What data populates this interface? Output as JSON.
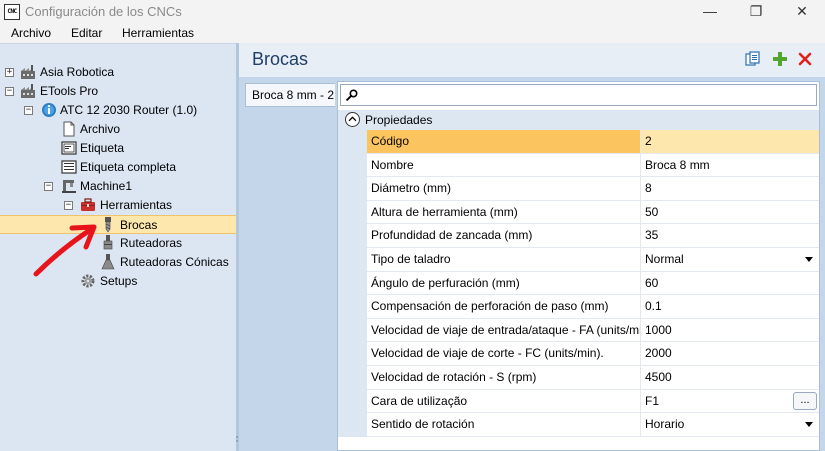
{
  "window": {
    "icon_text": "CNC",
    "title": "Configuración de los CNCs",
    "controls": {
      "minimize": "—",
      "maximize": "❐",
      "close": "✕"
    }
  },
  "menu": [
    "Archivo",
    "Editar",
    "Herramientas"
  ],
  "tree": {
    "items": [
      {
        "label": "Asia Robotica",
        "expander": "+",
        "icon": "factory-icon"
      },
      {
        "label": "ETools Pro",
        "expander": "−",
        "icon": "factory-icon"
      },
      {
        "label": "ATC 12 2030 Router (1.0)",
        "expander": "−",
        "icon": "info-globe-icon"
      },
      {
        "label": "Archivo",
        "icon": "document-icon"
      },
      {
        "label": "Etiqueta",
        "icon": "label-icon"
      },
      {
        "label": "Etiqueta completa",
        "icon": "full-label-icon"
      },
      {
        "label": "Machine1",
        "expander": "−",
        "icon": "machine-icon"
      },
      {
        "label": "Herramientas",
        "expander": "−",
        "icon": "toolbox-icon"
      },
      {
        "label": "Brocas",
        "icon": "drill-bit-icon",
        "selected": true
      },
      {
        "label": "Ruteadoras",
        "icon": "router-bit-icon"
      },
      {
        "label": "Ruteadoras Cónicas",
        "icon": "conical-router-icon"
      },
      {
        "label": "Setups",
        "icon": "gear-icon"
      }
    ]
  },
  "main": {
    "title": "Brocas",
    "toolbar": [
      "copy-icon",
      "add-icon",
      "delete-icon"
    ],
    "item_tab": "Broca 8 mm - 2",
    "search": {
      "value": ""
    },
    "category": "Propiedades",
    "properties": [
      {
        "name": "Código",
        "value": "2",
        "selected": true
      },
      {
        "name": "Nombre",
        "value": "Broca 8 mm"
      },
      {
        "name": "Diámetro (mm)",
        "value": "8"
      },
      {
        "name": "Altura de herramienta (mm)",
        "value": "50"
      },
      {
        "name": "Profundidad de zancada (mm)",
        "value": "35"
      },
      {
        "name": "Tipo de taladro",
        "value": "Normal",
        "editor": "dropdown"
      },
      {
        "name": "Ángulo de perfuración (mm)",
        "value": "60"
      },
      {
        "name": "Compensación de perforación de paso (mm)",
        "value": "0.1"
      },
      {
        "name": "Velocidad de viaje de entrada/ataque - FA (units/min)",
        "value": "1000"
      },
      {
        "name": "Velocidad de viaje de corte - FC (units/min).",
        "value": "2000"
      },
      {
        "name": "Velocidad de rotación - S (rpm)",
        "value": "4500"
      },
      {
        "name": "Cara de utilização",
        "value": "F1",
        "editor": "ellipsis",
        "button": "..."
      },
      {
        "name": "Sentido de rotación",
        "value": "Horario",
        "editor": "dropdown"
      }
    ]
  },
  "colors": {
    "tree_bg": "#dbe6f2",
    "selection": "#fde7ad",
    "selected_name_cell": "#fcc45e",
    "title_text": "#1f3f66",
    "annotation_arrow": "#e8141b"
  }
}
